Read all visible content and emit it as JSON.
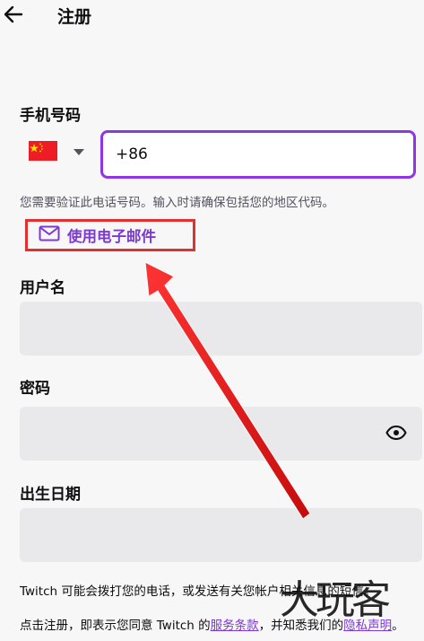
{
  "header": {
    "title": "注册"
  },
  "phone": {
    "label": "手机号码",
    "country_code_value": "+86",
    "hint": "您需要验证此电话号码。输入时请确保包括您的地区代码。"
  },
  "email_switch": {
    "label": "使用电子邮件"
  },
  "username": {
    "label": "用户名",
    "value": ""
  },
  "password": {
    "label": "密码",
    "value": ""
  },
  "birthdate": {
    "label": "出生日期",
    "value": ""
  },
  "footer": {
    "notice": "Twitch 可能会拨打您的电话，或发送有关您帐户相关信息的短信。",
    "agree_prefix": "点击注册，即表示您同意 Twitch 的",
    "terms_link": "服务条款",
    "agree_middle": "，并知悉我们的",
    "privacy_link": "隐私声明",
    "agree_suffix": "。"
  },
  "watermark": {
    "text": "大玩客"
  },
  "colors": {
    "accent": "#8f35e8",
    "link": "#7c3ad2",
    "annotation": "#e0312e",
    "field_bg": "#e9e9ec"
  },
  "icons": [
    "back-arrow-icon",
    "china-flag-icon",
    "chevron-down-icon",
    "mail-icon",
    "eye-icon"
  ]
}
